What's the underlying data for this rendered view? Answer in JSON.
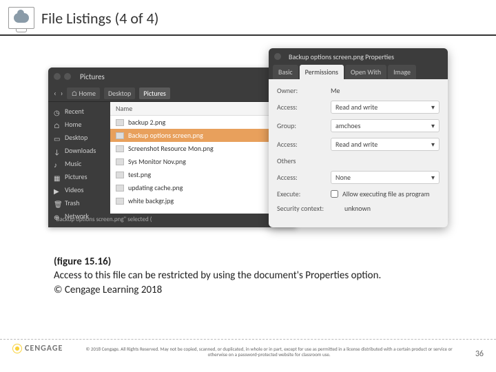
{
  "header": {
    "title": "File Listings (4 of 4)"
  },
  "fileManager": {
    "title": "Pictures",
    "breadcrumb": {
      "home": "Home",
      "desktop": "Desktop",
      "current": "Pictures"
    },
    "sidebar": [
      {
        "icon": "clock-icon",
        "label": "Recent"
      },
      {
        "icon": "home-icon",
        "label": "Home"
      },
      {
        "icon": "desktop-icon",
        "label": "Desktop"
      },
      {
        "icon": "download-icon",
        "label": "Downloads"
      },
      {
        "icon": "music-icon",
        "label": "Music"
      },
      {
        "icon": "pictures-icon",
        "label": "Pictures"
      },
      {
        "icon": "video-icon",
        "label": "Videos"
      },
      {
        "icon": "trash-icon",
        "label": "Trash"
      },
      {
        "icon": "network-icon",
        "label": "Network"
      }
    ],
    "listHeader": "Name",
    "files": [
      {
        "name": "backup 2.png",
        "selected": false
      },
      {
        "name": "Backup options screen.png",
        "selected": true
      },
      {
        "name": "Screenshot Resource Mon.png",
        "selected": false
      },
      {
        "name": "Sys Monitor Nov.png",
        "selected": false
      },
      {
        "name": "test.png",
        "selected": false
      },
      {
        "name": "updating cache.png",
        "selected": false
      },
      {
        "name": "white backgr.jpg",
        "selected": false
      }
    ],
    "status": "\"Backup options screen.png\" selected ("
  },
  "properties": {
    "title": "Backup options screen.png Properties",
    "tabs": [
      "Basic",
      "Permissions",
      "Open With",
      "Image"
    ],
    "activeTab": 1,
    "rows": {
      "ownerLabel": "Owner:",
      "ownerValue": "Me",
      "accessLabel1": "Access:",
      "accessValue1": "Read and write",
      "groupLabel": "Group:",
      "groupValue": "amchoes",
      "accessLabel2": "Access:",
      "accessValue2": "Read and write",
      "othersLabel": "Others",
      "accessLabel3": "Access:",
      "accessValue3": "None",
      "executeLabel": "Execute:",
      "executeCheck": "Allow executing file as program",
      "contextLabel": "Security context:",
      "contextValue": "unknown"
    }
  },
  "caption": {
    "figureNo": "(figure 15.16)",
    "text": "Access to this file can be restricted by using the document's Properties option.",
    "credit": "© Cengage Learning 2018"
  },
  "footer": {
    "brand": "CENGAGE",
    "copyright": "© 2018 Cengage. All Rights Reserved. May not be copied, scanned, or duplicated, in whole or in part, except for use as permitted in a license distributed with a certain product or service or otherwise on a password-protected website for classroom use.",
    "pageNum": "36"
  }
}
